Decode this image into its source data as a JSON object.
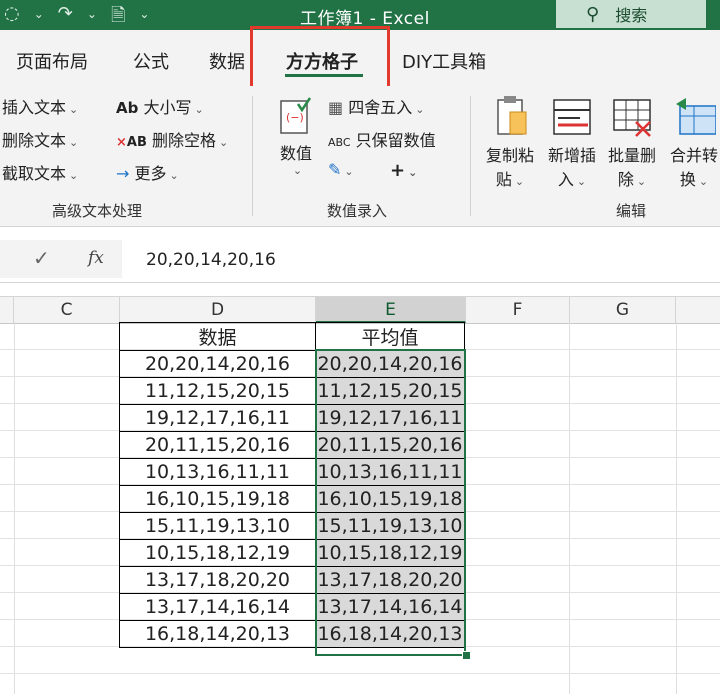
{
  "titlebar": {
    "title": "工作簿1  -  Excel",
    "search_label": "搜索",
    "icons": [
      "autosave-icon",
      "redo-icon",
      "dropdown-icon",
      "document-icon",
      "more-icon"
    ]
  },
  "tabs": [
    {
      "label": "页面布局"
    },
    {
      "label": "公式"
    },
    {
      "label": "数据"
    },
    {
      "label": "方方格子",
      "active": true
    },
    {
      "label": "DIY工具箱"
    }
  ],
  "ribbon": {
    "text_group": {
      "items": [
        "插入文本",
        "删除文本",
        "截取文本"
      ],
      "items2": [
        "大小写",
        "删除空格",
        "更多"
      ],
      "label": "高级文本处理"
    },
    "value_group": {
      "big_button": "数值",
      "items": [
        "四舍五入",
        "只保留数值"
      ],
      "plus": "+",
      "label": "数值录入"
    },
    "edit_group": {
      "buttons": [
        {
          "line1": "复制粘",
          "line2": "贴"
        },
        {
          "line1": "新增插",
          "line2": "入"
        },
        {
          "line1": "批量删",
          "line2": "除"
        },
        {
          "line1": "合并转",
          "line2": "换"
        }
      ],
      "label": "编辑"
    }
  },
  "formula_bar": {
    "content": "20,20,14,20,16"
  },
  "columns": [
    "C",
    "D",
    "E",
    "F",
    "G"
  ],
  "sheet": {
    "header_d": "数据",
    "header_e": "平均值",
    "rows": [
      "20,20,14,20,16",
      "11,12,15,20,15",
      "19,12,17,16,11",
      "20,11,15,20,16",
      "10,13,16,11,11",
      "16,10,15,19,18",
      "15,11,19,13,10",
      "10,15,18,12,19",
      "13,17,18,20,20",
      "13,17,14,16,14",
      "16,18,14,20,13"
    ]
  },
  "colors": {
    "accent": "#217346",
    "highlight": "#e2392d",
    "selection_fill": "#d9d9d9"
  }
}
